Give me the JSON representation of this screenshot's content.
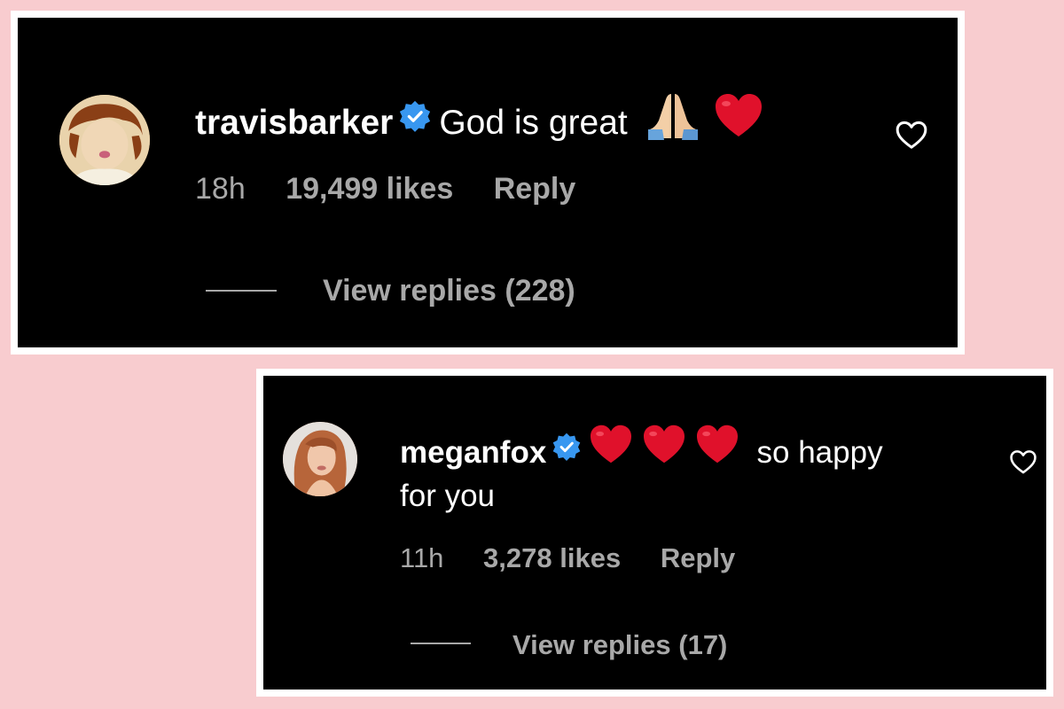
{
  "comments": [
    {
      "username": "travisbarker",
      "verified_icon": "verified-badge-icon",
      "text": "God is great",
      "emojis": [
        "🙏",
        "❤️"
      ],
      "time": "18h",
      "likes": "19,499 likes",
      "reply_label": "Reply",
      "view_replies": "View replies (228)",
      "like_icon": "heart-outline-icon"
    },
    {
      "username": "meganfox",
      "verified_icon": "verified-badge-icon",
      "emojis": [
        "❤️",
        "❤️",
        "❤️"
      ],
      "text_line1": "so happy",
      "text_line2": "for you",
      "time": "11h",
      "likes": "3,278 likes",
      "reply_label": "Reply",
      "view_replies": "View replies (17)",
      "like_icon": "heart-outline-icon"
    }
  ],
  "colors": {
    "background": "#f8cccf",
    "card": "#000000",
    "card_border": "#ffffff",
    "text": "#ffffff",
    "meta_text": "#a8a8a8",
    "verified_blue": "#3897f0",
    "heart_red": "#e0112b"
  }
}
